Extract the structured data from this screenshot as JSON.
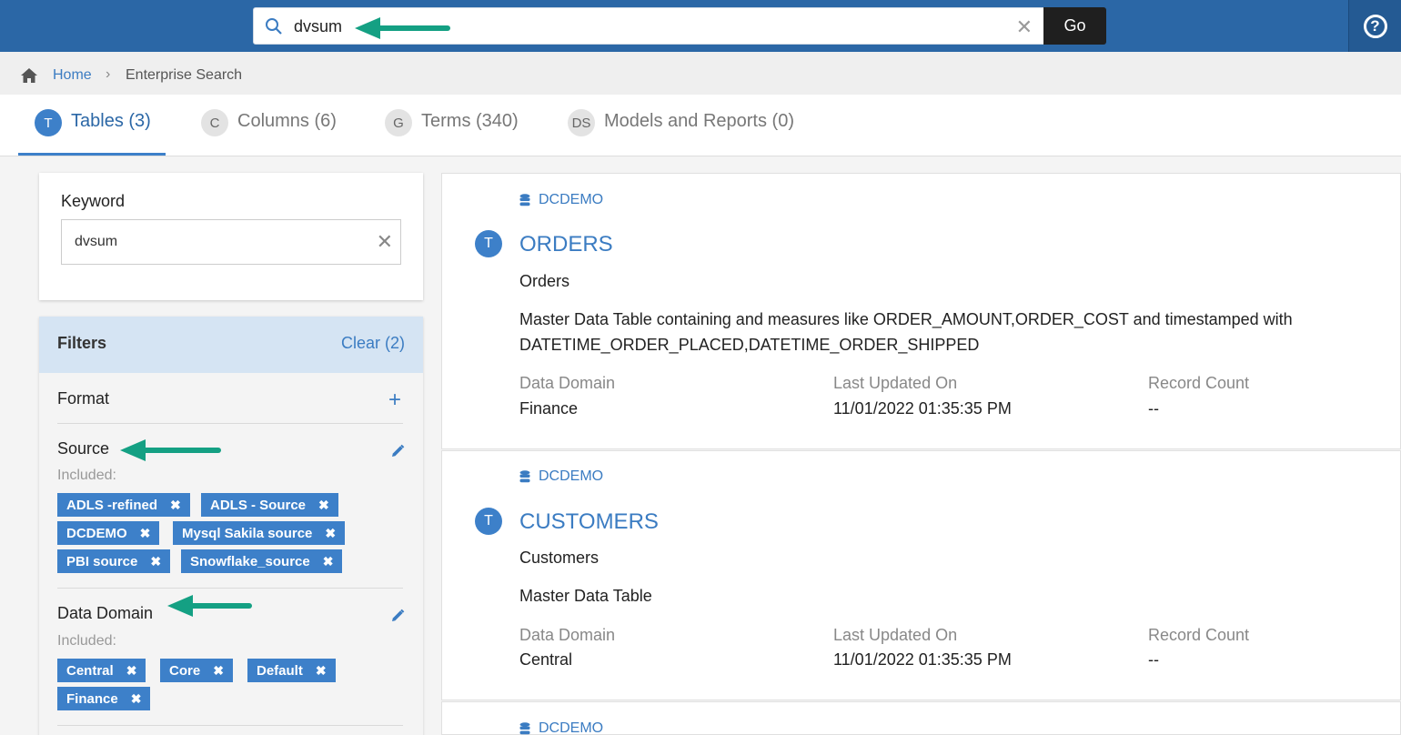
{
  "search": {
    "value": "dvsum",
    "go_label": "Go"
  },
  "breadcrumb": {
    "home": "Home",
    "current": "Enterprise Search"
  },
  "tabs": [
    {
      "badge": "T",
      "label": "Tables (3)"
    },
    {
      "badge": "C",
      "label": "Columns (6)"
    },
    {
      "badge": "G",
      "label": "Terms (340)"
    },
    {
      "badge": "DS",
      "label": "Models and Reports (0)"
    }
  ],
  "keyword": {
    "label": "Keyword",
    "value": "dvsum"
  },
  "filters": {
    "title": "Filters",
    "clear_label": "Clear (2)",
    "format_label": "Format",
    "source": {
      "label": "Source",
      "included_label": "Included:",
      "chips": [
        "ADLS -refined",
        "ADLS - Source",
        "DCDEMO",
        "Mysql Sakila source",
        "PBI source",
        "Snowflake_source"
      ]
    },
    "data_domain": {
      "label": "Data Domain",
      "included_label": "Included:",
      "chips": [
        "Central",
        "Core",
        "Default",
        "Finance"
      ]
    }
  },
  "results": [
    {
      "source": "DCDEMO",
      "badge": "T",
      "title": "ORDERS",
      "subtitle": "Orders",
      "description": "Master Data Table containing and measures like ORDER_AMOUNT,ORDER_COST and timestamped with DATETIME_ORDER_PLACED,DATETIME_ORDER_SHIPPED",
      "meta": {
        "domain_label": "Data Domain",
        "domain": "Finance",
        "updated_label": "Last Updated On",
        "updated": "11/01/2022 01:35:35 PM",
        "count_label": "Record Count",
        "count": "--"
      }
    },
    {
      "source": "DCDEMO",
      "badge": "T",
      "title": "CUSTOMERS",
      "subtitle": "Customers",
      "description": "Master Data Table",
      "meta": {
        "domain_label": "Data Domain",
        "domain": "Central",
        "updated_label": "Last Updated On",
        "updated": "11/01/2022 01:35:35 PM",
        "count_label": "Record Count",
        "count": "--"
      }
    },
    {
      "source": "DCDEMO"
    }
  ],
  "colors": {
    "header": "#2b67a6",
    "accent": "#3d80c9",
    "arrow": "#14a083",
    "go": "#1f1f1f"
  }
}
